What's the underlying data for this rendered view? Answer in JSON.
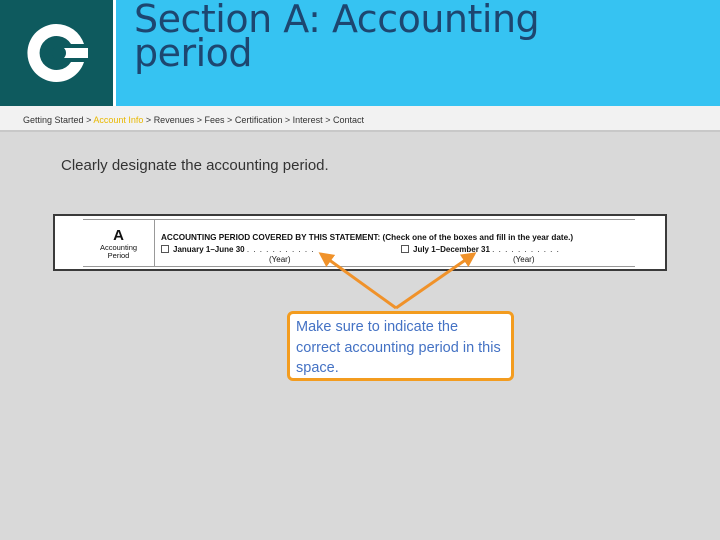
{
  "header": {
    "title_line1": "Section A: Accounting",
    "title_line2": "period"
  },
  "logo_icon": "c-logo-icon",
  "breadcrumb": {
    "items": [
      "Getting Started",
      "Account Info",
      "Revenues",
      "Fees",
      "Certification",
      "Interest",
      "Contact"
    ],
    "separator": ">",
    "active_index": 1
  },
  "main": {
    "instruction": "Clearly designate the accounting period."
  },
  "form_excerpt": {
    "section_letter": "A",
    "section_name": "Accounting Period",
    "heading": "ACCOUNTING PERIOD COVERED BY THIS STATEMENT: (Check one of the boxes and fill in the year date.)",
    "option1": "January 1–June 30",
    "option2": "July 1–December 31",
    "dots": ". . . . . . . . . . .",
    "year_label": "(Year)"
  },
  "callout": {
    "text": "Make sure to indicate the correct accounting period in this space."
  },
  "colors": {
    "logo_bg": "#0e5a5e",
    "title_band": "#36c3f2",
    "title_text": "#1d4670",
    "active_crumb": "#e8b800",
    "callout_border": "#f39c1f",
    "callout_text": "#4472c4",
    "arrow": "#f0922a",
    "background": "#d9d9d9"
  }
}
